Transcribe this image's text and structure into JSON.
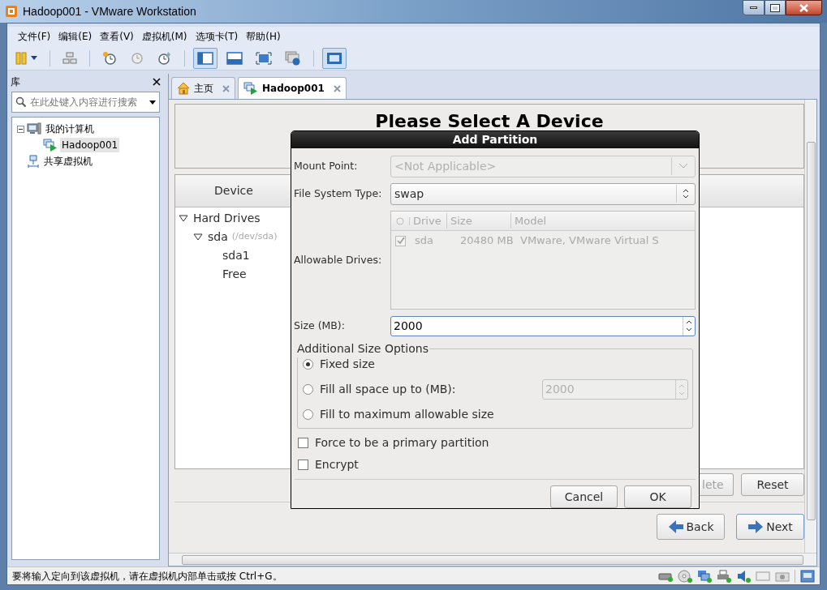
{
  "window": {
    "title": "Hadoop001 - VMware Workstation"
  },
  "menu": [
    "文件(F)",
    "编辑(E)",
    "查看(V)",
    "虚拟机(M)",
    "选项卡(T)",
    "帮助(H)"
  ],
  "toolbar": [
    {
      "kind": "pause",
      "pressed": false
    },
    {
      "kind": "network",
      "pressed": false
    },
    {
      "kind": "snapshot",
      "pressed": false
    },
    {
      "kind": "revert",
      "pressed": false
    },
    {
      "kind": "manage",
      "pressed": false
    },
    {
      "kind": "sidebar",
      "pressed": true
    },
    {
      "kind": "thumbs",
      "pressed": false
    },
    {
      "kind": "fullscreen",
      "pressed": false
    },
    {
      "kind": "info",
      "pressed": false
    },
    {
      "kind": "console",
      "pressed": true
    }
  ],
  "library": {
    "title": "库",
    "search": {
      "placeholder": "在此处键入内容进行搜索"
    },
    "tree": [
      {
        "label": "我的计算机",
        "kind": "computer",
        "expanded": true,
        "selected": false,
        "children": [
          {
            "label": "Hadoop001",
            "kind": "vm",
            "selected": true
          }
        ]
      },
      {
        "label": "共享虚拟机",
        "kind": "shared",
        "selected": false
      }
    ]
  },
  "tabs": [
    {
      "label": "主页",
      "kind": "home",
      "selected": false
    },
    {
      "label": "Hadoop001",
      "kind": "vm",
      "selected": true
    }
  ],
  "guest": {
    "heading": "Please Select A Device",
    "device_column": "Device",
    "tree": [
      {
        "label": "Hard Drives",
        "expanded": true,
        "children": [
          {
            "label": "sda",
            "path": "(/dev/sda)",
            "expanded": true,
            "children": [
              {
                "label": "sda1"
              },
              {
                "label": "Free"
              }
            ]
          }
        ]
      }
    ],
    "buttons": [
      {
        "label": "lete",
        "disabled": true
      },
      {
        "label": "Reset",
        "disabled": false
      }
    ],
    "nav": [
      {
        "label": "Back",
        "kind": "back"
      },
      {
        "label": "Next",
        "kind": "next"
      }
    ]
  },
  "dialog": {
    "title": "Add Partition",
    "fields": [
      {
        "label": "Mount Point:",
        "kind": "combo",
        "value": "<Not Applicable>",
        "disabled": true
      },
      {
        "label": "File System Type:",
        "kind": "select",
        "value": "swap",
        "disabled": false
      }
    ],
    "drives": {
      "label": "Allowable Drives:",
      "columns": [
        "Drive",
        "Size",
        "Model"
      ],
      "rows": [
        {
          "checked": true,
          "drive": "sda",
          "size": "20480 MB",
          "model": "VMware, VMware Virtual S"
        }
      ]
    },
    "size": {
      "label": "Size (MB):",
      "value": "2000"
    },
    "options": {
      "title": "Additional Size Options",
      "items": [
        {
          "label": "Fixed size",
          "selected": true
        },
        {
          "label": "Fill all space up to (MB):",
          "selected": false,
          "value": "2000",
          "disabled": true
        },
        {
          "label": "Fill to maximum allowable size",
          "selected": false
        }
      ]
    },
    "checks": [
      {
        "label": "Force to be a primary partition",
        "checked": false
      },
      {
        "label": "Encrypt",
        "checked": false
      }
    ],
    "buttons": [
      "Cancel",
      "OK"
    ]
  },
  "status_bar": {
    "text": "要将输入定向到该虚拟机，请在虚拟机内部单击或按 Ctrl+G。"
  }
}
